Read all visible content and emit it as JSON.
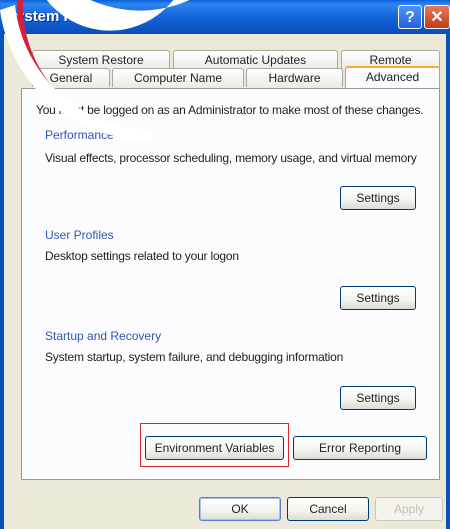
{
  "window": {
    "title": "System Properties",
    "help_glyph": "?",
    "close_glyph": "✕"
  },
  "tabs_row1": [
    "System Restore",
    "Automatic Updates",
    "Remote"
  ],
  "tabs_row2": [
    "General",
    "Computer Name",
    "Hardware",
    "Advanced"
  ],
  "active_tab": "Advanced",
  "admin_note": "You must be logged on as an Administrator to make most of these changes.",
  "performance": {
    "header": "Performance",
    "description": "Visual effects, processor scheduling, memory usage, and virtual memory",
    "button": "Settings"
  },
  "user_profiles": {
    "header": "User Profiles",
    "description": "Desktop settings related to your logon",
    "button": "Settings"
  },
  "startup_recovery": {
    "header": "Startup and Recovery",
    "description": "System startup, system failure, and debugging information",
    "button": "Settings"
  },
  "env_button": "Environment Variables",
  "error_button": "Error Reporting",
  "footer": {
    "ok": "OK",
    "cancel": "Cancel",
    "apply": "Apply"
  },
  "colors": {
    "title_bar": "#0b4fb8",
    "group_header": "#2f55b5",
    "highlight_box": "#d12a2a",
    "logo_accent": "#d61f3a"
  }
}
